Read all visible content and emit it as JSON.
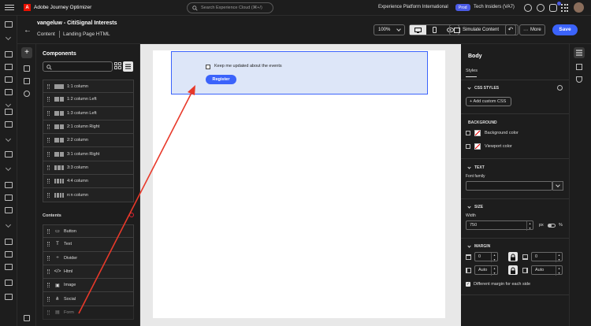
{
  "topbar": {
    "app_name": "Adobe Journey Optimizer",
    "logo_letter": "A",
    "search_placeholder": "Search Experience Cloud (⌘+/)",
    "org_name": "Experience Platform International",
    "env_badge": "Prod",
    "sandbox_name": "Tech Insiders (VA7)"
  },
  "header": {
    "title": "vangeluw - CitiSignal Interests",
    "crumb_1": "Content",
    "crumb_2": "Landing Page HTML",
    "zoom": "100%",
    "simulate_label": "Simulate Content",
    "more_label": "More",
    "save_label": "Save"
  },
  "components": {
    "heading": "Components",
    "structures": [
      {
        "label": "1:1 column",
        "cols": 1
      },
      {
        "label": "1:2 column Left",
        "cols": 2
      },
      {
        "label": "1:3 column Left",
        "cols": 2
      },
      {
        "label": "2:1 column Right",
        "cols": 2
      },
      {
        "label": "2:2 column",
        "cols": 2
      },
      {
        "label": "3:1 column Right",
        "cols": 2
      },
      {
        "label": "3:3 column",
        "cols": 3
      },
      {
        "label": "4:4 column",
        "cols": 4
      },
      {
        "label": "n:n column",
        "cols": 4
      }
    ],
    "contents_heading": "Contents",
    "contents": [
      {
        "label": "Button",
        "icon": "button-icon",
        "glyph": "▭"
      },
      {
        "label": "Text",
        "icon": "text-icon",
        "glyph": "T"
      },
      {
        "label": "Divider",
        "icon": "divider-icon",
        "glyph": "÷"
      },
      {
        "label": "Html",
        "icon": "html-icon",
        "glyph": "</>"
      },
      {
        "label": "Image",
        "icon": "image-icon",
        "glyph": "▣"
      },
      {
        "label": "Social",
        "icon": "social-icon",
        "glyph": "⋔"
      },
      {
        "label": "Form",
        "icon": "form-icon",
        "glyph": "▤"
      }
    ]
  },
  "canvas": {
    "checkbox_label": "Keep me updated about the events",
    "register_label": "Register"
  },
  "properties": {
    "title": "Body",
    "tab": "Styles",
    "css_section": "CSS STYLES",
    "add_css_label": "Add custom CSS",
    "background_section": "BACKGROUND",
    "background_color_label": "Background color",
    "viewport_color_label": "Viewport color",
    "text_section": "TEXT",
    "font_family_label": "Font family",
    "font_family_value": "",
    "size_section": "SIZE",
    "width_label": "Width",
    "width_value": "750",
    "unit_px": "px",
    "unit_pct": "%",
    "margin_section": "MARGIN",
    "margin_top": "0",
    "margin_bottom": "0",
    "margin_left": "Auto",
    "margin_right": "Auto",
    "different_margin_label": "Different margin for each side"
  },
  "colors": {
    "accent": "#3b63fb",
    "annotation_arrow": "#e8392a",
    "brand": "#eb1000"
  }
}
